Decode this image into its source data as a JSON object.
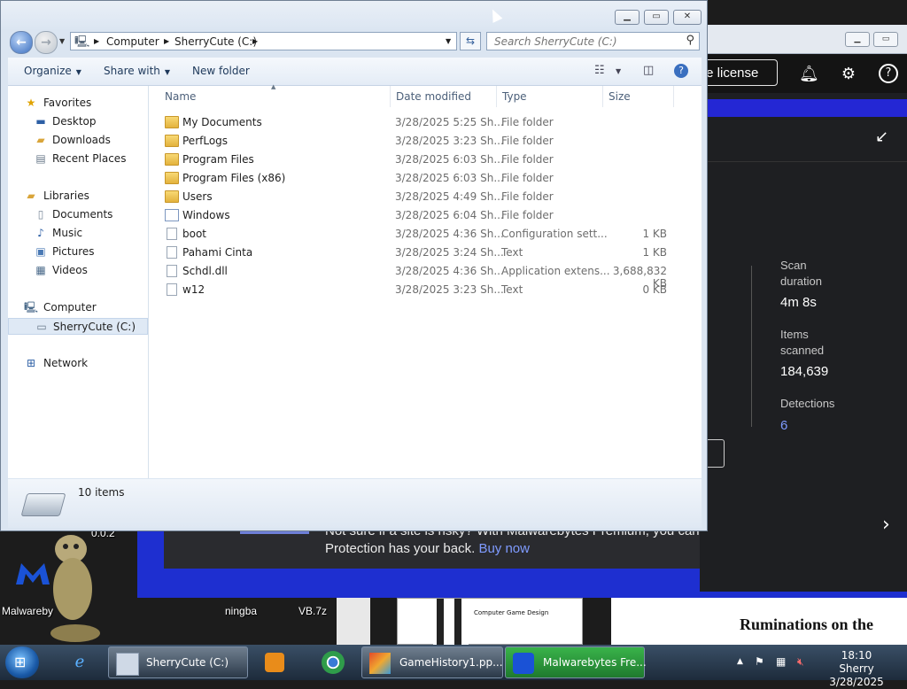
{
  "explorer": {
    "address": {
      "crumbs": [
        "Computer",
        "SherryCute (C:)"
      ]
    },
    "search": {
      "placeholder": "Search SherryCute (C:)"
    },
    "toolbar": {
      "organize": "Organize",
      "share_with": "Share with",
      "new_folder": "New folder"
    },
    "sidebar": {
      "favorites": {
        "label": "Favorites",
        "items": [
          "Desktop",
          "Downloads",
          "Recent Places"
        ]
      },
      "libraries": {
        "label": "Libraries",
        "items": [
          "Documents",
          "Music",
          "Pictures",
          "Videos"
        ]
      },
      "computer": {
        "label": "Computer",
        "items": [
          "SherryCute (C:)"
        ]
      },
      "network": {
        "label": "Network"
      }
    },
    "columns": {
      "name": "Name",
      "date": "Date modified",
      "type": "Type",
      "size": "Size"
    },
    "files": [
      {
        "name": "My Documents",
        "date": "3/28/2025 5:25 Sh...",
        "type": "File folder",
        "size": "",
        "icon": "folder"
      },
      {
        "name": "PerfLogs",
        "date": "3/28/2025 3:23 Sh...",
        "type": "File folder",
        "size": "",
        "icon": "folder"
      },
      {
        "name": "Program Files",
        "date": "3/28/2025 6:03 Sh...",
        "type": "File folder",
        "size": "",
        "icon": "folder"
      },
      {
        "name": "Program Files (x86)",
        "date": "3/28/2025 6:03 Sh...",
        "type": "File folder",
        "size": "",
        "icon": "folder"
      },
      {
        "name": "Users",
        "date": "3/28/2025 4:49 Sh...",
        "type": "File folder",
        "size": "",
        "icon": "folder"
      },
      {
        "name": "Windows",
        "date": "3/28/2025 6:04 Sh...",
        "type": "File folder",
        "size": "",
        "icon": "windows-folder"
      },
      {
        "name": "boot",
        "date": "3/28/2025 4:36 Sh...",
        "type": "Configuration sett...",
        "size": "1 KB",
        "icon": "config-file"
      },
      {
        "name": "Pahami Cinta",
        "date": "3/28/2025 3:24 Sh...",
        "type": "Text",
        "size": "1 KB",
        "icon": "text-file"
      },
      {
        "name": "Schdl.dll",
        "date": "3/28/2025 4:36 Sh...",
        "type": "Application extens...",
        "size": "3,688,832 KB",
        "icon": "dll-file"
      },
      {
        "name": "w12",
        "date": "3/28/2025 3:23 Sh...",
        "type": "Text",
        "size": "0 KB",
        "icon": "text-file"
      }
    ],
    "status": {
      "count": "10 items"
    }
  },
  "malwarebytes": {
    "license_button": "te license",
    "stats": [
      {
        "label": "Scan duration",
        "value": "4m 8s"
      },
      {
        "label": "Items scanned",
        "value": "184,639"
      },
      {
        "label": "Detections",
        "value": "6"
      }
    ],
    "banner": {
      "text": "Not sure if a site is risky? With Malwarebytes Premium, you can visit it anyway knowing Web Protection has your back.",
      "link": "Buy now"
    }
  },
  "desktop": {
    "labels": {
      "version": "0.0.2",
      "malwarebytes": "Malwareby",
      "ningba": "ningba",
      "vb7z": "VB.7z"
    },
    "doc_title": "Ruminations on the",
    "thumb_text": "Computer Game Design"
  },
  "taskbar": {
    "tasks": [
      "SherryCute (C:)",
      "GameHistory1.pp...",
      "Malwarebytes Fre..."
    ],
    "clock": {
      "time": "18:10 Sherry",
      "date": "3/28/2025"
    }
  }
}
